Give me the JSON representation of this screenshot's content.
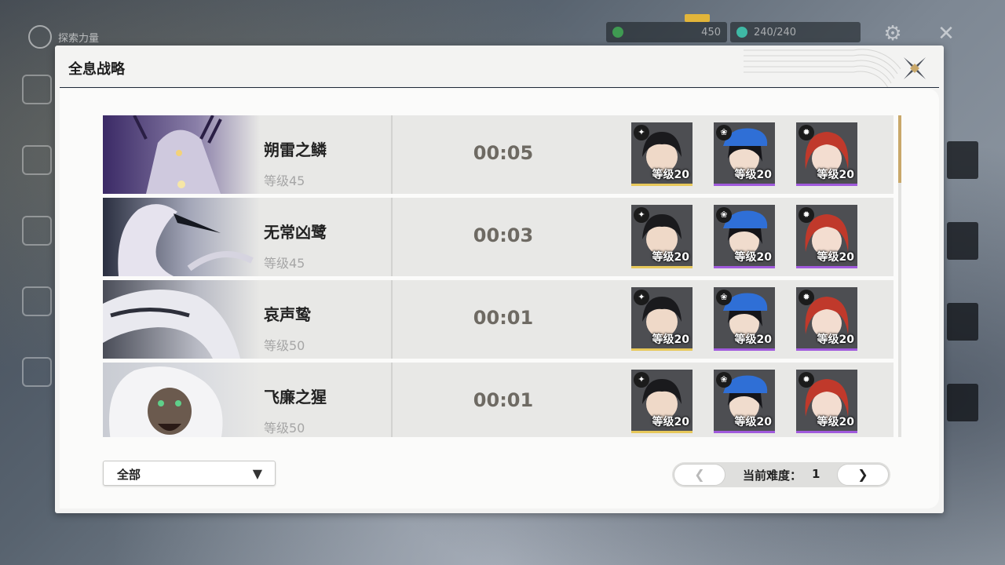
{
  "background": {
    "top_title": "探索力量",
    "resource_a": "450",
    "resource_b": "240/240"
  },
  "dialog": {
    "title": "全息战略",
    "bosses": [
      {
        "name": "朔雷之鳞",
        "level": "等级45",
        "time": "00:05",
        "team": [
          {
            "level": "等级20"
          },
          {
            "level": "等级20"
          },
          {
            "level": "等级20"
          }
        ]
      },
      {
        "name": "无常凶鹭",
        "level": "等级45",
        "time": "00:03",
        "team": [
          {
            "level": "等级20"
          },
          {
            "level": "等级20"
          },
          {
            "level": "等级20"
          }
        ]
      },
      {
        "name": "哀声鸷",
        "level": "等级50",
        "time": "00:01",
        "team": [
          {
            "level": "等级20"
          },
          {
            "level": "等级20"
          },
          {
            "level": "等级20"
          }
        ]
      },
      {
        "name": "飞廉之猩",
        "level": "等级50",
        "time": "00:01",
        "team": [
          {
            "level": "等级20"
          },
          {
            "level": "等级20"
          },
          {
            "level": "等级20"
          }
        ]
      }
    ],
    "filter": {
      "label": "全部",
      "icon": "chevron-down-icon"
    },
    "pager": {
      "prev": "❮",
      "next": "❯",
      "label": "当前难度：",
      "value": "1"
    },
    "colors": {
      "rarity_gold": "#e7c85a",
      "rarity_purple": "#a05adc",
      "time_text": "#6e6a63",
      "scroll_thumb": "#c9a86a"
    },
    "character_elements": [
      "spectro-icon",
      "aero-icon",
      "fusion-icon"
    ]
  }
}
